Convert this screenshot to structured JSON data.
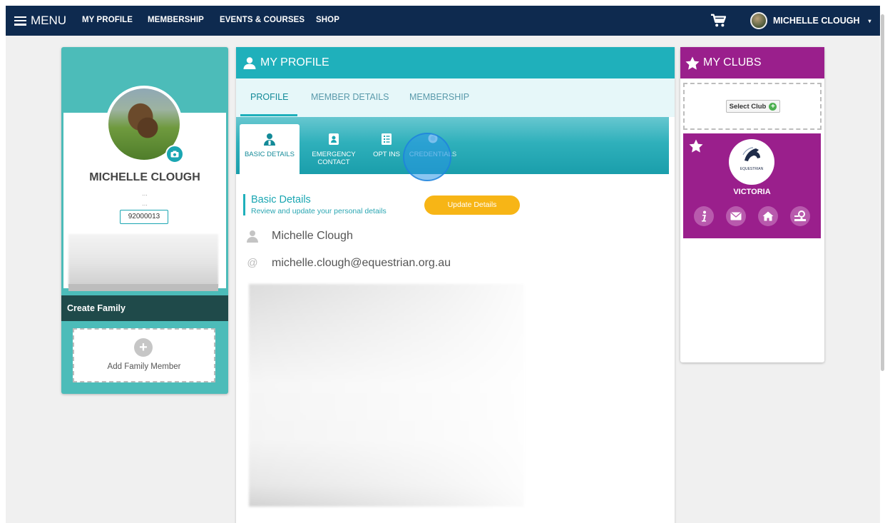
{
  "nav": {
    "menu_label": "MENU",
    "links": [
      "MY PROFILE",
      "MEMBERSHIP",
      "EVENTS & COURSES",
      "SHOP"
    ],
    "user_name": "MICHELLE CLOUGH"
  },
  "left": {
    "name": "MICHELLE CLOUGH",
    "dots1": "...",
    "dots2": "...",
    "member_number": "92000013",
    "create_family": "Create Family",
    "add_family_member": "Add Family Member"
  },
  "main": {
    "header": "MY PROFILE",
    "tabs": [
      "PROFILE",
      "MEMBER DETAILS",
      "MEMBERSHIP"
    ],
    "subtabs": {
      "basic": "BASIC DETAILS",
      "emergency": "EMERGENCY CONTACT",
      "optins": "OPT INS",
      "credentials": "CREDENTIALS"
    },
    "section_title": "Basic Details",
    "section_subtitle": "Review and update your personal details",
    "update_button": "Update Details",
    "full_name": "Michelle Clough",
    "email": "michelle.clough@equestrian.org.au",
    "email_prefix": "@"
  },
  "right": {
    "header": "MY CLUBS",
    "select_club": "Select Club",
    "club_name": "VICTORIA",
    "club_logo_text": "EQUESTRIAN"
  },
  "colors": {
    "nav": "#0e2a4f",
    "teal": "#1fb0bb",
    "purple": "#9a1f8c",
    "amber": "#f7b516"
  }
}
